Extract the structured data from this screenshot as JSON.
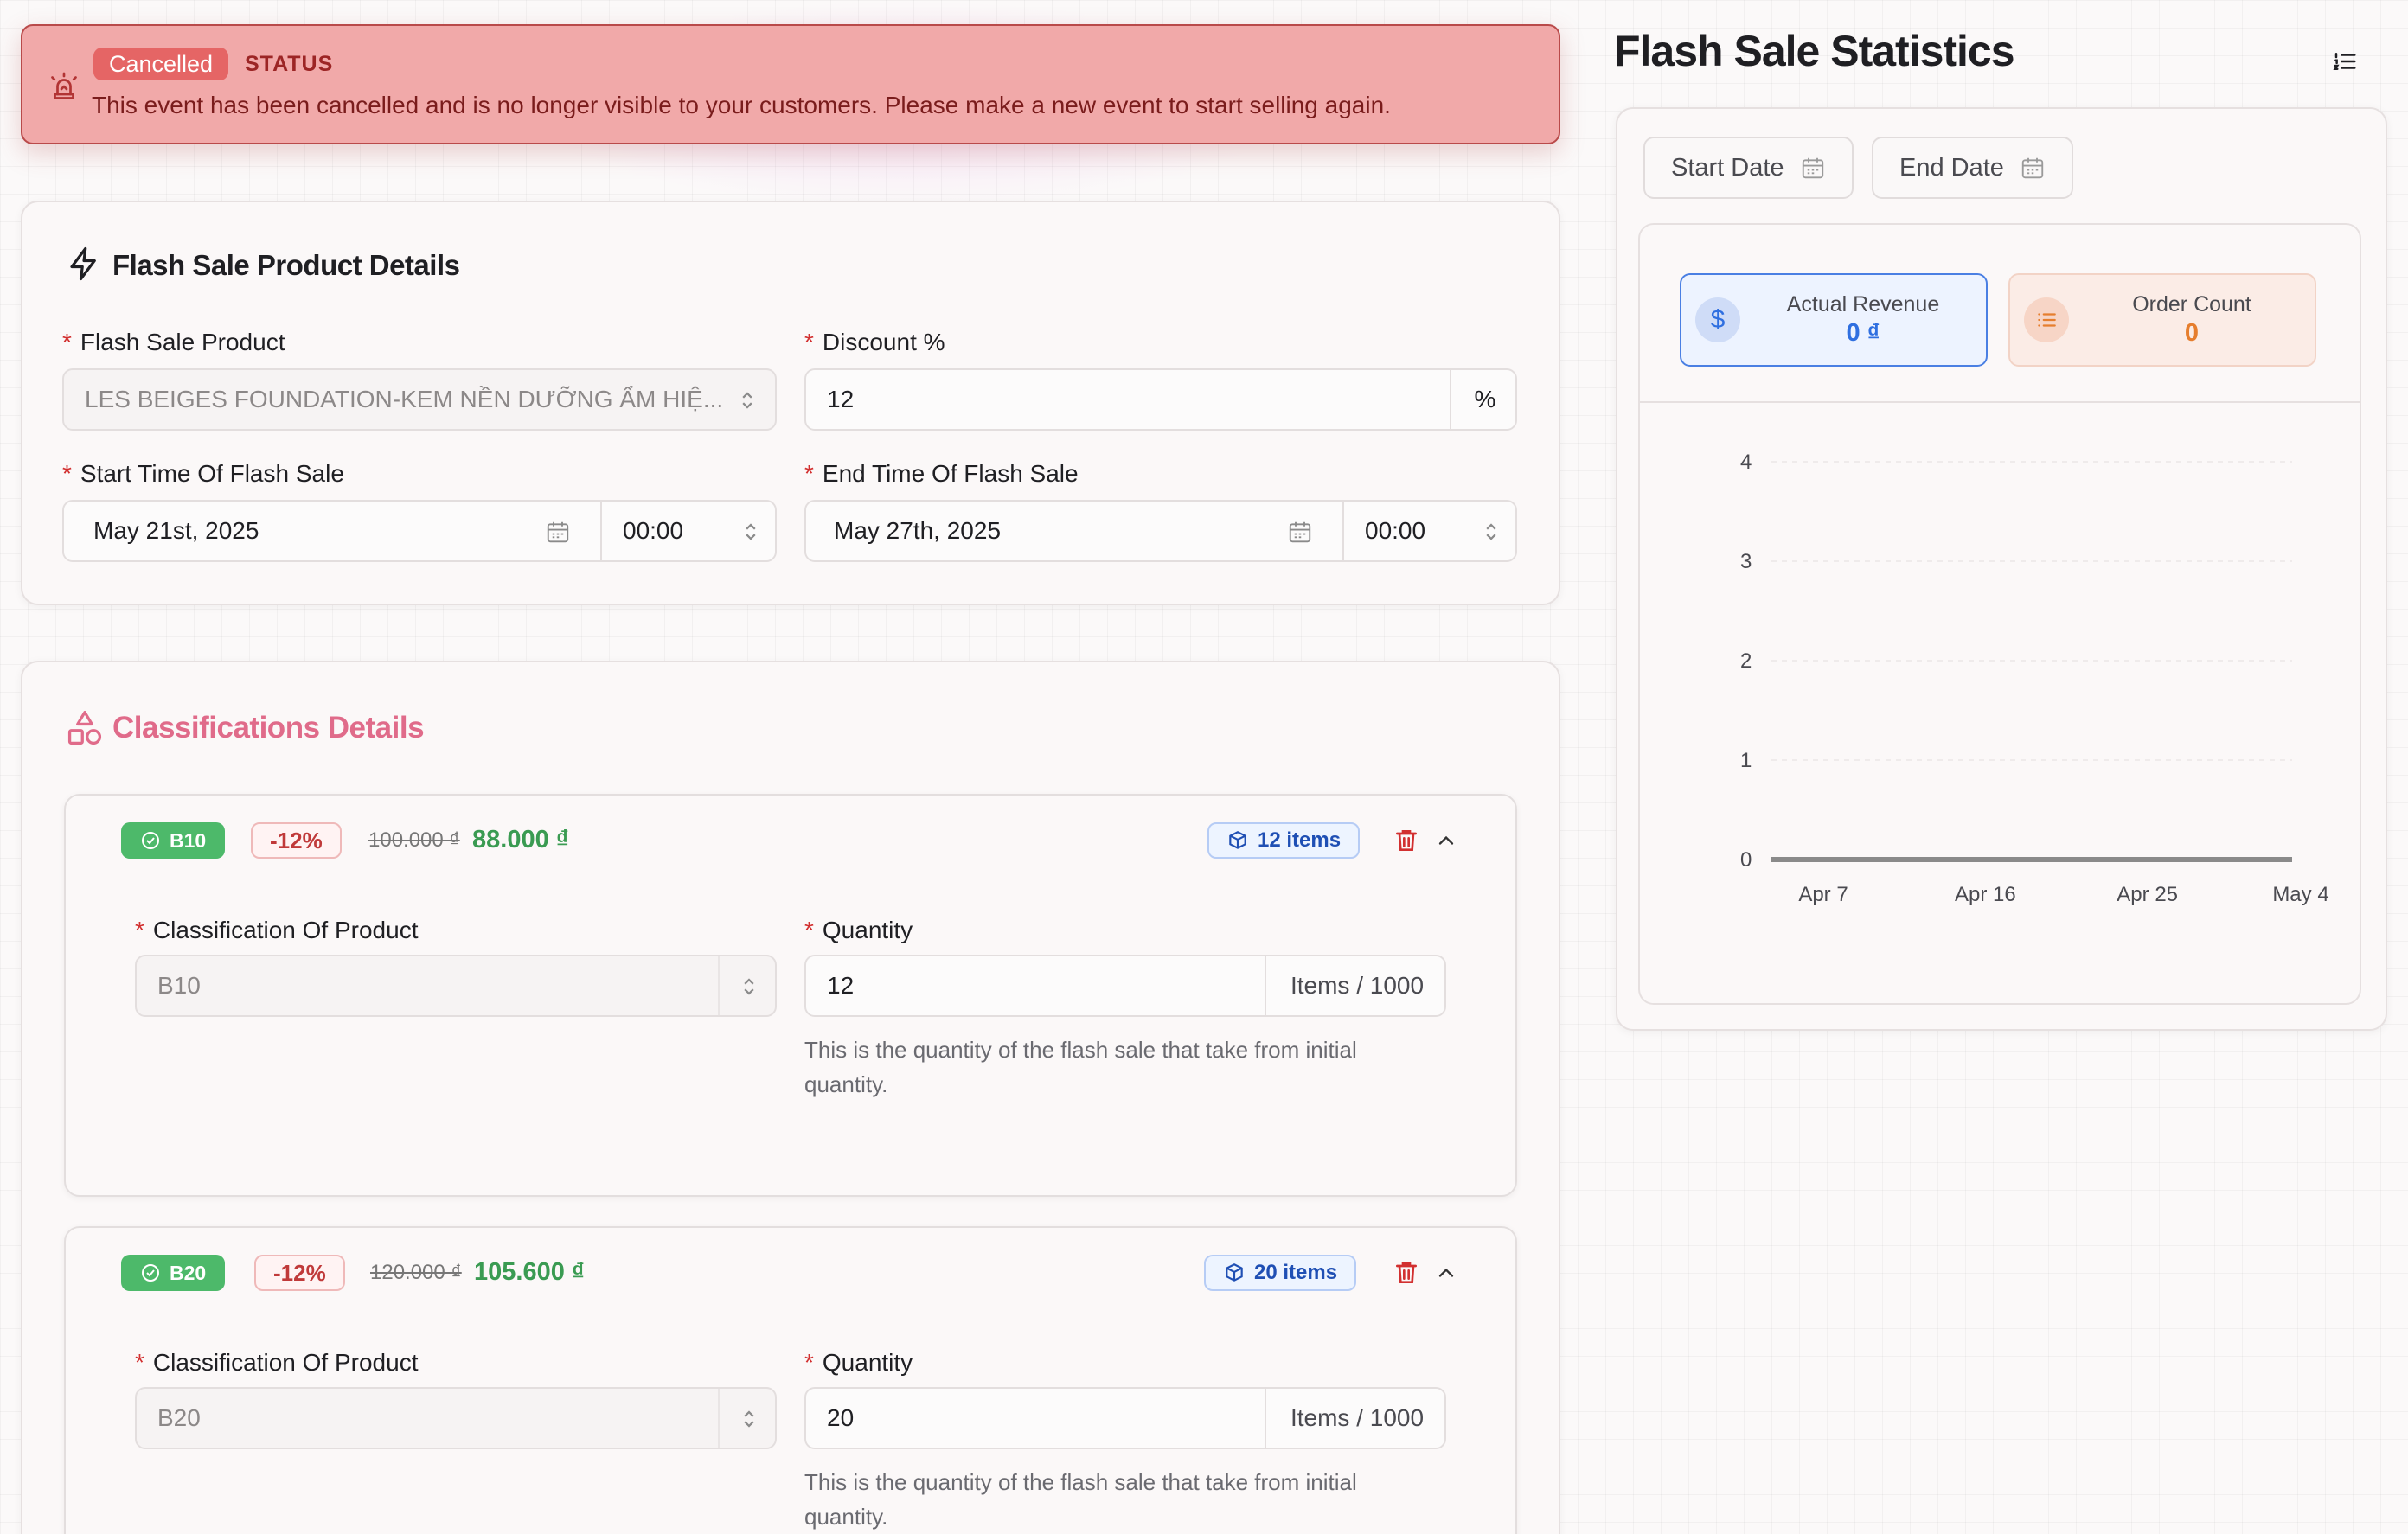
{
  "alert": {
    "badge": "Cancelled",
    "status_label": "STATUS",
    "message": "This event has been cancelled and is no longer visible to your customers. Please make a new event to start selling again."
  },
  "product": {
    "title": "Flash Sale Product Details",
    "product_label": "Flash Sale Product",
    "product_value": "LES BEIGES FOUNDATION-KEM NỀN DƯỠNG ẨM HIỆ...",
    "discount_label": "Discount %",
    "discount_value": "12",
    "discount_unit": "%",
    "start_label": "Start Time Of Flash Sale",
    "start_date": "May 21st, 2025",
    "start_time": "00:00",
    "end_label": "End Time Of Flash Sale",
    "end_date": "May 27th, 2025",
    "end_time": "00:00"
  },
  "classifications": {
    "title": "Classifications Details",
    "items": [
      {
        "code": "B10",
        "discount": "-12%",
        "old_price": "100.000 ₫",
        "new_price": "88.000 ₫",
        "items": "12 items",
        "class_label": "Classification Of Product",
        "class_value": "B10",
        "qty_label": "Quantity",
        "qty_value": "12",
        "qty_suffix": "Items / 1000",
        "help": "This is the quantity of the flash sale that take from initial quantity."
      },
      {
        "code": "B20",
        "discount": "-12%",
        "old_price": "120.000 ₫",
        "new_price": "105.600 ₫",
        "items": "20 items",
        "class_label": "Classification Of Product",
        "class_value": "B20",
        "qty_label": "Quantity",
        "qty_value": "20",
        "qty_suffix": "Items / 1000",
        "help": "This is the quantity of the flash sale that take from initial quantity."
      }
    ]
  },
  "stats": {
    "title": "Flash Sale Statistics",
    "start_date_label": "Start Date",
    "end_date_label": "End Date",
    "revenue_label": "Actual Revenue",
    "revenue_value": "0 ₫",
    "orders_label": "Order Count",
    "orders_value": "0"
  },
  "chart_data": {
    "type": "line",
    "x": [
      "Apr 7",
      "Apr 16",
      "Apr 25",
      "May 4"
    ],
    "y_ticks": [
      0,
      1,
      2,
      3,
      4
    ],
    "ylim": [
      0,
      4
    ],
    "series": [
      {
        "values": [
          0,
          0,
          0,
          0
        ]
      }
    ],
    "grid": true
  },
  "colors": {
    "alert_bg": "#f1a9a9",
    "success": "#4db96a",
    "danger": "#d23030",
    "accent_blue": "#2f6fe0",
    "accent_orange": "#e67e2e",
    "classification_title": "#e06b8a"
  }
}
